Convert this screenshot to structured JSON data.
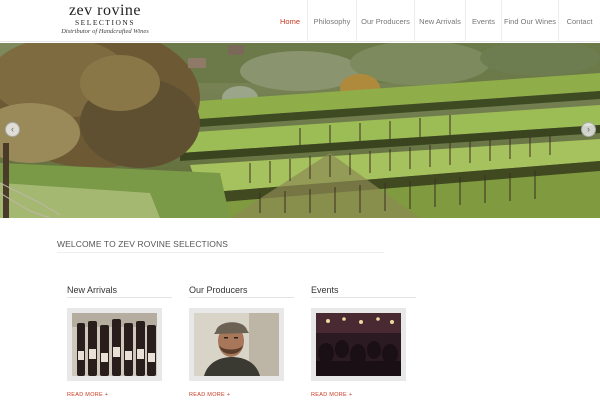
{
  "header": {
    "logo_main": "zev rovine",
    "logo_sub": "SELECTIONS",
    "logo_tagline": "Distributor of Handcrafted Wines"
  },
  "nav": {
    "items": [
      {
        "label": "Home",
        "active": true
      },
      {
        "label": "Philosophy",
        "active": false
      },
      {
        "label": "Our Producers",
        "active": false
      },
      {
        "label": "New Arrivals",
        "active": false
      },
      {
        "label": "Events",
        "active": false
      },
      {
        "label": "Find Our Wines",
        "active": false
      },
      {
        "label": "Contact",
        "active": false
      }
    ]
  },
  "slider": {
    "prev_icon": "chevron-left-icon",
    "next_icon": "chevron-right-icon"
  },
  "welcome": {
    "heading": "WELCOME TO ZEV ROVINE SELECTIONS"
  },
  "columns": [
    {
      "title": "New Arrivals",
      "read_more": "READ MORE +"
    },
    {
      "title": "Our Producers",
      "read_more": "READ MORE +"
    },
    {
      "title": "Events",
      "read_more": "READ MORE +"
    }
  ],
  "colors": {
    "accent": "#c8391f",
    "nav_text": "#777777",
    "thumb_frame": "#e8e8e8"
  }
}
